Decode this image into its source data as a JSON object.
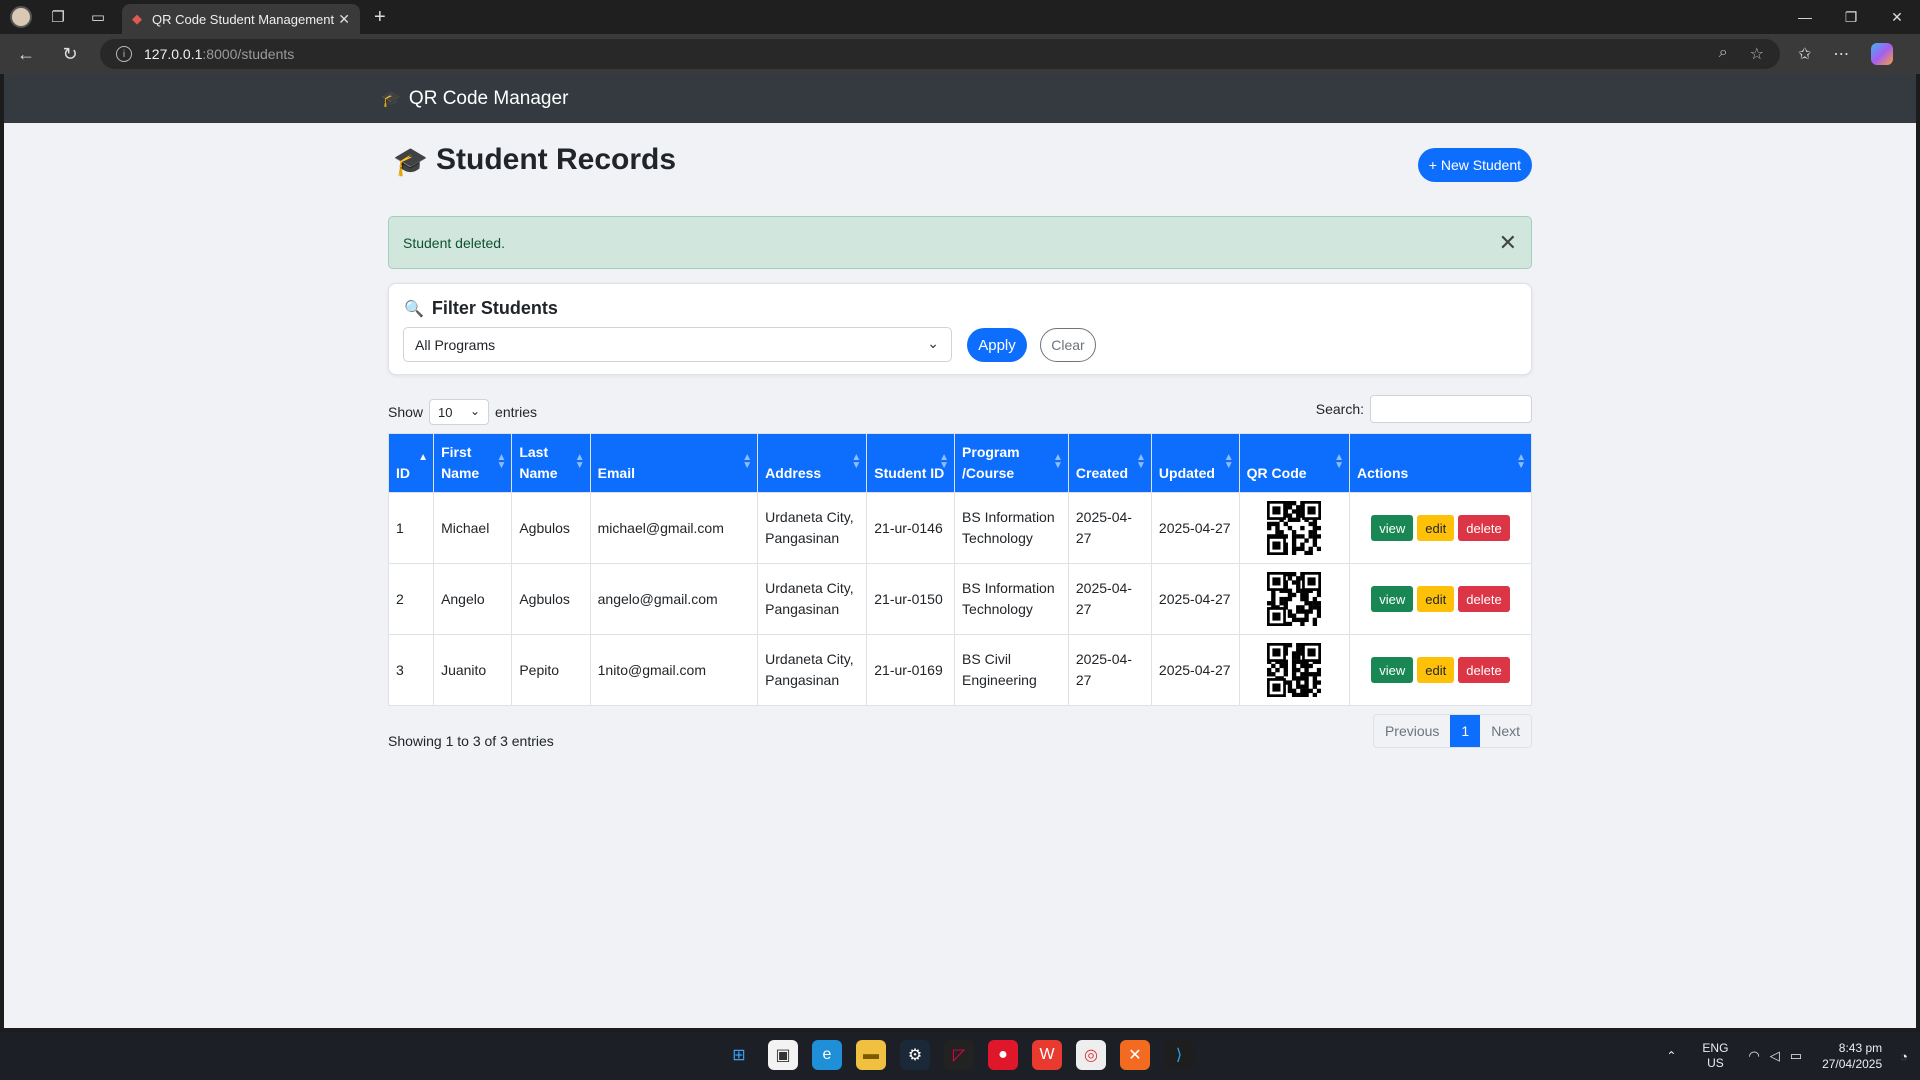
{
  "browser": {
    "tab_title": "QR Code Student Management",
    "url_host": "127.0.0.1",
    "url_path": ":8000/students"
  },
  "navbar": {
    "brand": "QR Code Manager"
  },
  "page": {
    "title": "Student Records",
    "new_button": "+ New Student"
  },
  "alert": {
    "message": "Student deleted."
  },
  "filter": {
    "title": "Filter Students",
    "program_selected": "All Programs",
    "apply_label": "Apply",
    "clear_label": "Clear"
  },
  "datatable": {
    "show_label": "Show",
    "length_value": "10",
    "entries_label": "entries",
    "search_label": "Search:",
    "columns": [
      "ID",
      "First Name",
      "Last Name",
      "Email",
      "Address",
      "Student ID",
      "Program /Course",
      "Created",
      "Updated",
      "QR Code",
      "Actions"
    ],
    "rows": [
      {
        "id": "1",
        "first": "Michael",
        "last": "Agbulos",
        "email": "michael@gmail.com",
        "address": "Urdaneta City, Pangasinan",
        "student_id": "21-ur-0146",
        "program": "BS Information Technology",
        "created": "2025-04-27",
        "updated": "2025-04-27"
      },
      {
        "id": "2",
        "first": "Angelo",
        "last": "Agbulos",
        "email": "angelo@gmail.com",
        "address": "Urdaneta City, Pangasinan",
        "student_id": "21-ur-0150",
        "program": "BS Information Technology",
        "created": "2025-04-27",
        "updated": "2025-04-27"
      },
      {
        "id": "3",
        "first": "Juanito",
        "last": "Pepito",
        "email": "1nito@gmail.com",
        "address": "Urdaneta City, Pangasinan",
        "student_id": "21-ur-0169",
        "program": "BS Civil Engineering",
        "created": "2025-04-27",
        "updated": "2025-04-27"
      }
    ],
    "action_view": "view",
    "action_edit": "edit",
    "action_delete": "delete",
    "info": "Showing 1 to 3 of 3 entries",
    "prev_label": "Previous",
    "page_label": "1",
    "next_label": "Next"
  },
  "taskbar": {
    "lang_top": "ENG",
    "lang_bottom": "US",
    "time": "8:43 pm",
    "date": "27/04/2025"
  },
  "colors": {
    "primary": "#0d6efd",
    "success": "#198754",
    "warning": "#ffc107",
    "danger": "#dc3545",
    "navbar": "#343a40"
  }
}
